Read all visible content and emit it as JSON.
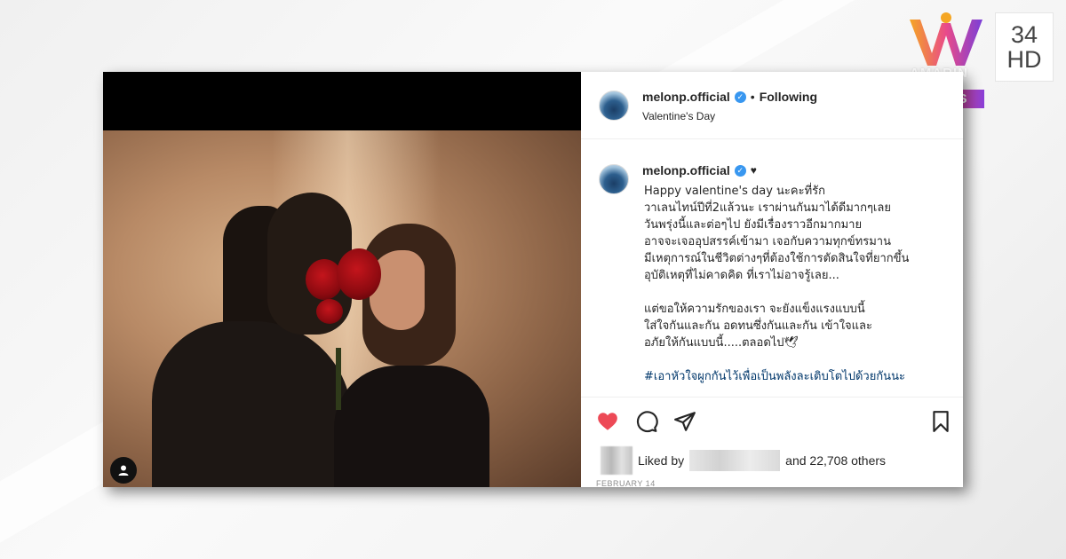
{
  "post": {
    "username": "melonp.official",
    "follow_status": "Following",
    "location": "Valentine's Day",
    "caption_emoji": "♥",
    "caption_text": "Happy valentine's day นะคะที่รัก\nวาเลนไทน์ปีที่2แล้วนะ เราผ่านกันมาได้ดีมากๆเลย\nวันพรุ่งนี้และต่อๆไป ยังมีเรื่องราวอีกมากมาย\nอาจจะเจออุปสรรค์เข้ามา เจอกับความทุกข์ทรมาน\nมีเหตุการณ์ในชีวิตต่างๆที่ต้องใช้การตัดสินใจที่ยากขึ้น\nอุบัติเหตุที่ไม่คาดคิด ที่เราไม่อาจรู้เลย...\n\nแต่ขอให้ความรักของเรา จะยังแข็งแรงแบบนี้\nใส่ใจกันและกัน อดทนซึ่งกันและกัน เข้าใจและ\nอภัยให้กันแบบนี้.....ตลอดไป🕊",
    "hashtag": "#เอาหัวใจผูกกันไว้เพื่อเป็นพลังละเติบโตไปด้วยกันนะ",
    "liked_by_prefix": "Liked by",
    "liked_by_suffix": "and 22,708 others",
    "date": "FEBRUARY 14"
  },
  "icons": {
    "like": "heart-icon",
    "comment": "comment-icon",
    "share": "share-icon",
    "save": "bookmark-icon",
    "verified": "verified-badge-icon",
    "tagged_user": "user-tag-icon"
  },
  "channel": {
    "brand": "AMARIN",
    "news_label": "NEWS",
    "channel_number": "34",
    "channel_hd": "HD"
  },
  "colors": {
    "heart": "#ed4956",
    "verified": "#3897f0",
    "hashtag": "#00376b",
    "news_gradient_start": "#f5a623",
    "news_gradient_end": "#8a3fd8"
  }
}
